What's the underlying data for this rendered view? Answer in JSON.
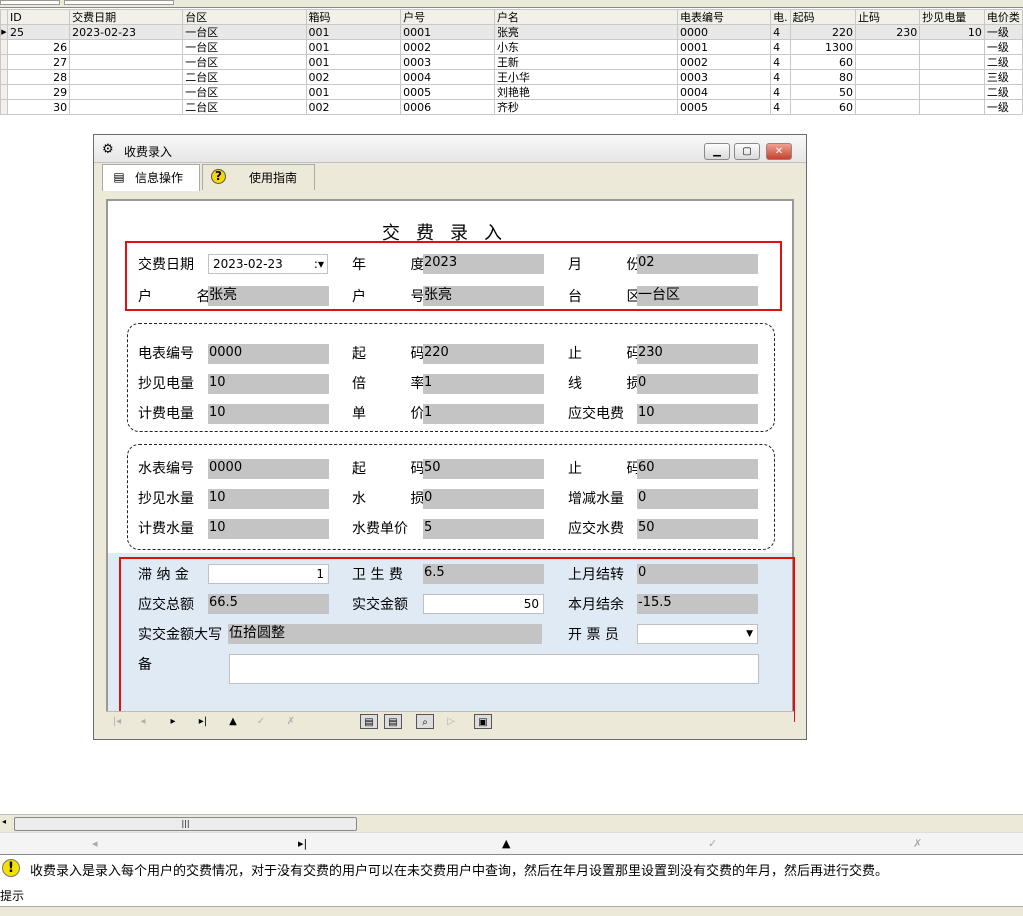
{
  "grid": {
    "headers": [
      "ID",
      "交费日期",
      "台区",
      "箱码",
      "户号",
      "户名",
      "电表编号",
      "电.",
      "起码",
      "止码",
      "抄见电量",
      "电价类"
    ],
    "rows": [
      [
        "25",
        "2023-02-23",
        "一台区",
        "001",
        "0001",
        "张亮",
        "0000",
        "4",
        "220",
        "230",
        "10",
        "一级"
      ],
      [
        "26",
        "",
        "一台区",
        "001",
        "0002",
        "小东",
        "0001",
        "4",
        "1300",
        "",
        "",
        "一级"
      ],
      [
        "27",
        "",
        "一台区",
        "001",
        "0003",
        "王新",
        "0002",
        "4",
        "60",
        "",
        "",
        "二级"
      ],
      [
        "28",
        "",
        "二台区",
        "002",
        "0004",
        "王小华",
        "0003",
        "4",
        "80",
        "",
        "",
        "三级"
      ],
      [
        "29",
        "",
        "一台区",
        "001",
        "0005",
        "刘艳艳",
        "0004",
        "4",
        "50",
        "",
        "",
        "二级"
      ],
      [
        "30",
        "",
        "二台区",
        "002",
        "0006",
        "齐秒",
        "0005",
        "4",
        "60",
        "",
        "",
        "一级"
      ]
    ]
  },
  "window": {
    "title": "收费录入",
    "tabs": [
      "信息操作",
      "使用指南"
    ],
    "form_title": "交费录入"
  },
  "top": {
    "date_label": "交费日期",
    "date_value": "2023-02-23",
    "year_label": "年 度",
    "year_value": "2023",
    "month_label": "月 份",
    "month_value": "02",
    "name_label": "户 名",
    "name_value": "张亮",
    "no_label": "户 号",
    "no_value": "张亮",
    "area_label": "台 区",
    "area_value": "一台区"
  },
  "elec": {
    "meter_label": "电表编号",
    "meter_value": "0000",
    "start_label": "起 码",
    "start_value": "220",
    "end_label": "止 码",
    "end_value": "230",
    "read_label": "抄见电量",
    "read_value": "10",
    "ratio_label": "倍 率",
    "ratio_value": "1",
    "loss_label": "线 损",
    "loss_value": "0",
    "bill_label": "计费电量",
    "bill_value": "10",
    "price_label": "单 价",
    "price_value": "1",
    "due_label": "应交电费",
    "due_value": "10"
  },
  "water": {
    "meter_label": "水表编号",
    "meter_value": "0000",
    "start_label": "起 码",
    "start_value": "50",
    "end_label": "止 码",
    "end_value": "60",
    "read_label": "抄见水量",
    "read_value": "10",
    "loss_label": "水 损",
    "loss_value": "0",
    "adj_label": "增减水量",
    "adj_value": "0",
    "bill_label": "计费水量",
    "bill_value": "10",
    "price_label": "水费单价",
    "price_value": "5",
    "due_label": "应交水费",
    "due_value": "50"
  },
  "pay": {
    "late_label": "滞 纳 金",
    "late_value": "1",
    "san_label": "卫 生 费",
    "san_value": "6.5",
    "prev_label": "上月结转",
    "prev_value": "0",
    "total_label": "应交总额",
    "total_value": "66.5",
    "actual_label": "实交金额",
    "actual_value": "50",
    "bal_label": "本月结余",
    "bal_value": "-15.5",
    "upper_label": "实交金额大写",
    "upper_value": "伍拾圆整",
    "clerk_label": "开 票 员",
    "clerk_value": "",
    "note_label": "备 注",
    "note_value": ""
  },
  "hint": {
    "text": "收费录入是录入每个用户的交费情况，对于没有交费的用户可以在未交费用户中查询，然后在年月设置那里设置到没有交费的年月，然后再进行交费。",
    "label": "提示"
  },
  "colors": {
    "red_box": "#e01010",
    "readonly": "#c4c4c4",
    "lower_bg": "#dfeaf4"
  }
}
